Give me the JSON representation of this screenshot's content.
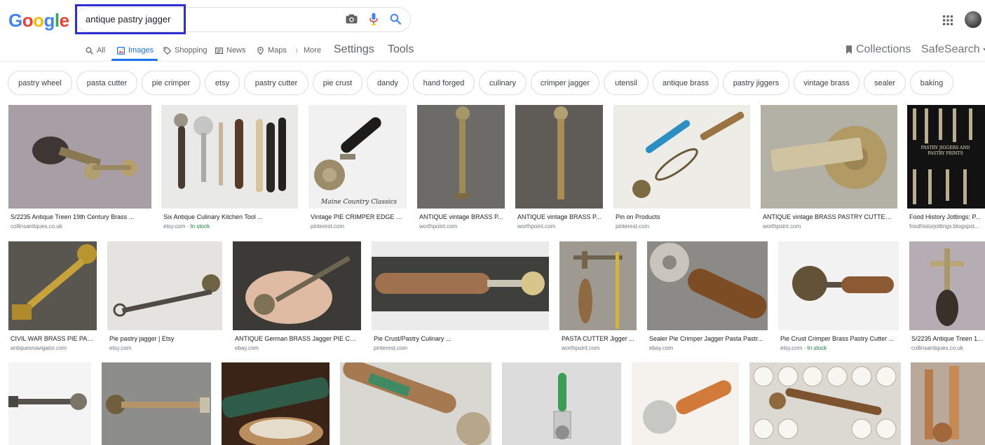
{
  "logo": [
    "G",
    "o",
    "o",
    "g",
    "l",
    "e"
  ],
  "search": {
    "query": "antique pastry jagger"
  },
  "tabs": [
    {
      "label": "All",
      "icon": "search-icon"
    },
    {
      "label": "Images",
      "icon": "image-icon",
      "active": true
    },
    {
      "label": "Shopping",
      "icon": "tag-icon"
    },
    {
      "label": "News",
      "icon": "newspaper-icon"
    },
    {
      "label": "Maps",
      "icon": "map-pin-icon"
    },
    {
      "label": "More",
      "icon": "more-vert-icon"
    }
  ],
  "settings_label": "Settings",
  "tools_label": "Tools",
  "collections_label": "Collections",
  "safesearch_label": "SafeSearch",
  "chips": [
    "pastry wheel",
    "pasta cutter",
    "pie crimper",
    "etsy",
    "pastry cutter",
    "pie crust",
    "dandy",
    "hand forged",
    "culinary",
    "crimper jagger",
    "utensil",
    "antique brass",
    "pastry jiggers",
    "vintage brass",
    "sealer",
    "baking"
  ],
  "results_row1": [
    {
      "title": "S/2235 Antique Treen 19th Century Brass ...",
      "source": "collinsantiques.co.uk",
      "stock": ""
    },
    {
      "title": "Six Antique Culinary Kitchen Tool ...",
      "source": "etsy.com",
      "stock": " · In stock"
    },
    {
      "title": "Vintage PIE CRIMPER EDGE TR...",
      "source": "pinterest.com",
      "stock": "",
      "watermark": "Maine Country Classics"
    },
    {
      "title": "ANTIQUE vintage BRASS P...",
      "source": "worthpoint.com",
      "stock": ""
    },
    {
      "title": "ANTIQUE vintage BRASS P...",
      "source": "worthpoint.com",
      "stock": ""
    },
    {
      "title": "Pin on Products",
      "source": "pinterest.com",
      "stock": ""
    },
    {
      "title": "ANTIQUE vintage BRASS PASTRY CUTTER ...",
      "source": "worthpoint.com",
      "stock": ""
    },
    {
      "title": "Food History Jottings: P...",
      "source": "foodhistorjottings.blogspot...",
      "stock": "",
      "book": "PASTRY JIGGERS AND PASTRY PRINTS"
    }
  ],
  "results_row2": [
    {
      "title": "CIVIL WAR BRASS PIE PAS...",
      "source": "antiquesnavigator.com",
      "stock": ""
    },
    {
      "title": "Pie pastry jagger | Etsy",
      "source": "etsy.com",
      "stock": ""
    },
    {
      "title": "ANTIQUE German BRASS Jagger PIE CRI...",
      "source": "ebay.com",
      "stock": ""
    },
    {
      "title": "Pie Crust/Pastry Culinary ...",
      "source": "pinterest.com",
      "stock": ""
    },
    {
      "title": "PASTA CUTTER Jigger ...",
      "source": "worthpoint.com",
      "stock": ""
    },
    {
      "title": "Sealer Pie Crimper Jagger Pasta Pastr...",
      "source": "ebay.com",
      "stock": ""
    },
    {
      "title": "Pie Crust Crimper Brass Pastry Cutter ...",
      "source": "etsy.com",
      "stock": " · In stock"
    },
    {
      "title": "S/2235 Antique Treen 1...",
      "source": "collinsantiques.co.uk",
      "stock": ""
    }
  ],
  "colors": {
    "accent": "#1a73e8",
    "highlight_box": "#2f2fd1",
    "in_stock": "#188038"
  }
}
